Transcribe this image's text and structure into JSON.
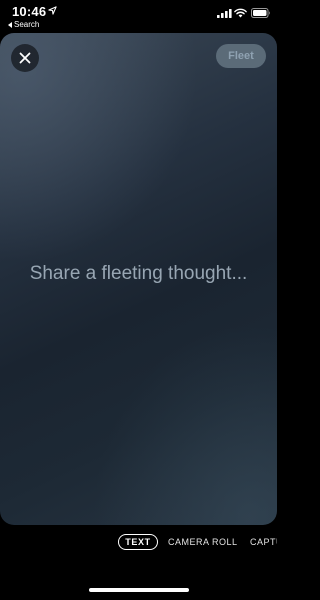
{
  "status_bar": {
    "time": "10:46",
    "back_app_label": "Search",
    "icons": [
      "location-arrow-icon",
      "cellular-signal-icon",
      "wifi-icon",
      "battery-icon"
    ]
  },
  "composer": {
    "close_icon": "close-icon",
    "fleet_button_label": "Fleet",
    "placeholder": "Share a fleeting thought..."
  },
  "modes": {
    "items": [
      "TEXT",
      "CAMERA ROLL",
      "CAPTU"
    ],
    "selected": "TEXT"
  },
  "colors": {
    "background": "#000000",
    "fleet_button_bg": "#5b6b78",
    "placeholder_text": "#98a6b3"
  }
}
